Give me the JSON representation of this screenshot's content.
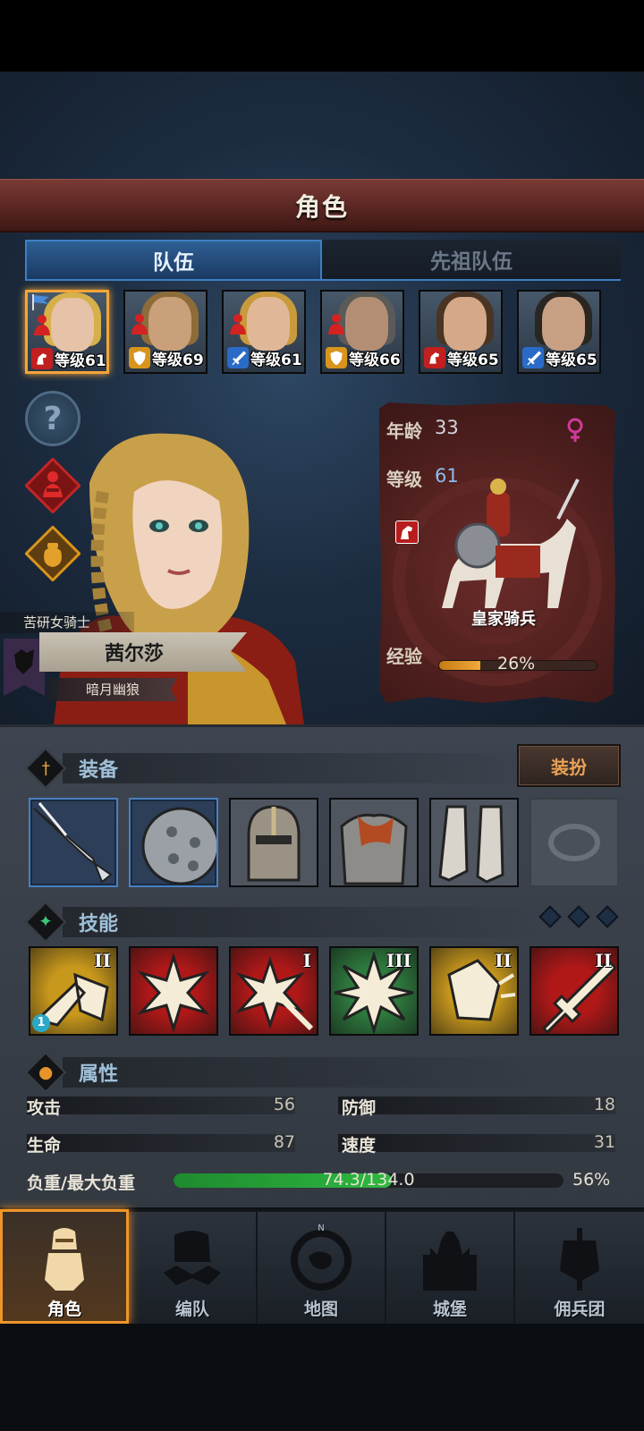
{
  "header": {
    "title": "角色"
  },
  "tabs": [
    {
      "label": "队伍",
      "active": true
    },
    {
      "label": "先祖队伍",
      "active": false
    }
  ],
  "roster": [
    {
      "level": "等级61",
      "class_icon": "horse-icon",
      "class_color": "#c21f1f",
      "hair": "#d6b04a",
      "skin": "#e6c2a8",
      "injured": true,
      "leader_flag": true,
      "selected": true
    },
    {
      "level": "等级69",
      "class_icon": "shield-icon",
      "class_color": "#d8941c",
      "hair": "#8e6c3a",
      "skin": "#c9a07a",
      "injured": true,
      "leader_flag": false,
      "selected": false
    },
    {
      "level": "等级61",
      "class_icon": "sword-icon",
      "class_color": "#2a6bc8",
      "hair": "#c99a3c",
      "skin": "#e0b898",
      "injured": true,
      "leader_flag": false,
      "selected": false
    },
    {
      "level": "等级66",
      "class_icon": "shield-icon",
      "class_color": "#d8941c",
      "hair": "#5a5a58",
      "skin": "#b48e74",
      "injured": true,
      "leader_flag": false,
      "selected": false
    },
    {
      "level": "等级65",
      "class_icon": "horse-icon",
      "class_color": "#c21f1f",
      "hair": "#4a3424",
      "skin": "#d4a888",
      "injured": false,
      "leader_flag": false,
      "selected": false
    },
    {
      "level": "等级65",
      "class_icon": "sword-icon",
      "class_color": "#2a6bc8",
      "hair": "#2a2622",
      "skin": "#c8a084",
      "injured": false,
      "leader_flag": false,
      "selected": false
    }
  ],
  "character": {
    "title": "苦研女骑士",
    "name": "茜尔莎",
    "guild": "暗月幽狼"
  },
  "info": {
    "age_label": "年龄",
    "age": "33",
    "level_label": "等级",
    "level": "61",
    "class_name": "皇家骑兵",
    "exp_label": "经验",
    "exp_percent_text": "26%",
    "exp_fraction": 0.26,
    "gender": "female"
  },
  "equipment": {
    "title": "装备",
    "dress_button": "装扮",
    "slots": [
      "lance-icon",
      "round-shield-icon",
      "helmet-icon",
      "chainmail-armor-icon",
      "greaves-icon",
      "ring-icon"
    ]
  },
  "skills": {
    "title": "技能",
    "items": [
      {
        "icon": "shield-charge-icon",
        "rank": "II",
        "color": "#c8981c",
        "badge": "1"
      },
      {
        "icon": "burst-strike-icon",
        "rank": "",
        "color": "#b01818",
        "badge": ""
      },
      {
        "icon": "burst-arrow-icon",
        "rank": "I",
        "color": "#b01818",
        "badge": ""
      },
      {
        "icon": "starburst-icon",
        "rank": "III",
        "color": "#2e7a3e",
        "badge": ""
      },
      {
        "icon": "shield-bash-icon",
        "rank": "II",
        "color": "#c8981c",
        "badge": ""
      },
      {
        "icon": "sword-icon",
        "rank": "II",
        "color": "#b01818",
        "badge": ""
      }
    ]
  },
  "attributes": {
    "title": "属性",
    "attack_label": "攻击",
    "attack": "56",
    "defense_label": "防御",
    "defense": "18",
    "hp_label": "生命",
    "hp": "87",
    "speed_label": "速度",
    "speed": "31",
    "load_label": "负重/最大负重",
    "load_text": "74.3/134.0",
    "load_percent_text": "56%",
    "load_fraction": 0.56
  },
  "nav": [
    {
      "label": "角色",
      "icon": "knight-icon",
      "active": true
    },
    {
      "label": "编队",
      "icon": "formation-icon",
      "active": false
    },
    {
      "label": "地图",
      "icon": "compass-map-icon",
      "active": false
    },
    {
      "label": "城堡",
      "icon": "castle-icon",
      "active": false
    },
    {
      "label": "佣兵团",
      "icon": "mercenary-banner-icon",
      "active": false
    }
  ]
}
